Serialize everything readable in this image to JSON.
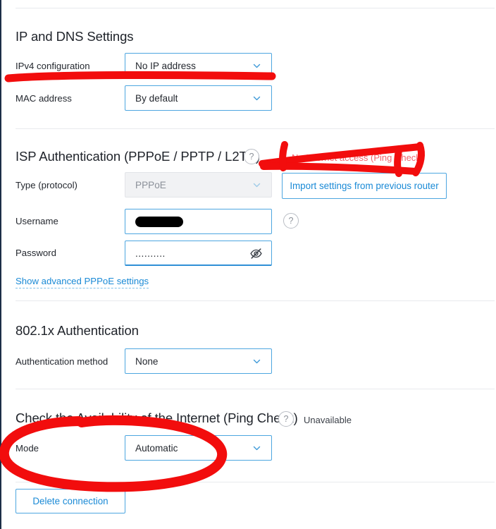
{
  "sections": [
    {
      "id": "ip-dns",
      "title": "IP and DNS Settings",
      "rows": [
        {
          "label": "IPv4 configuration",
          "value": "No IP address",
          "control": "select",
          "state": "enabled"
        },
        {
          "label": "MAC address",
          "value": "By default",
          "control": "select",
          "state": "enabled"
        }
      ]
    },
    {
      "id": "isp-auth",
      "title": "ISP Authentication (PPPoE / PPTP / L2TP)",
      "status": "No Internet access (Ping Check)",
      "status_color": "#f4636c",
      "import_button": "Import settings from previous router",
      "advanced_link": "Show advanced PPPoE settings",
      "rows": [
        {
          "label": "Type (protocol)",
          "value": "PPPoE",
          "control": "select",
          "state": "disabled"
        },
        {
          "label": "Username",
          "value": "",
          "control": "text",
          "state": "redacted"
        },
        {
          "label": "Password",
          "value": "..........",
          "control": "password",
          "state": "masked"
        }
      ]
    },
    {
      "id": "dot1x",
      "title": "802.1x Authentication",
      "rows": [
        {
          "label": "Authentication method",
          "value": "None",
          "control": "select",
          "state": "enabled"
        }
      ]
    },
    {
      "id": "ping-check",
      "title": "Check the Availability of the Internet (Ping Check)",
      "status": "Unavailable",
      "status_color": "#3a3f47",
      "rows": [
        {
          "label": "Mode",
          "value": "Automatic",
          "control": "select",
          "state": "enabled"
        }
      ]
    }
  ],
  "delete_button": "Delete connection",
  "icons": {
    "help": "?",
    "chevron": "chevron-down-icon",
    "eye_off": "eye-off-icon"
  },
  "colors": {
    "accent_blue": "#1a8ad6",
    "border_blue": "#4da6e0",
    "annotation_red": "#f20d0d",
    "status_red": "#f4636c",
    "divider": "#e8eaed",
    "rail": "#1c2e47"
  },
  "annotation": {
    "tool": "red-marker",
    "marks": [
      {
        "name": "strike-ipv4-configuration",
        "shape": "thick-horizontal-stroke"
      },
      {
        "name": "bracket-no-internet-access",
        "shape": "bracket-with-underline"
      },
      {
        "name": "ellipse-mode-automatic",
        "shape": "large-ellipse"
      }
    ]
  }
}
